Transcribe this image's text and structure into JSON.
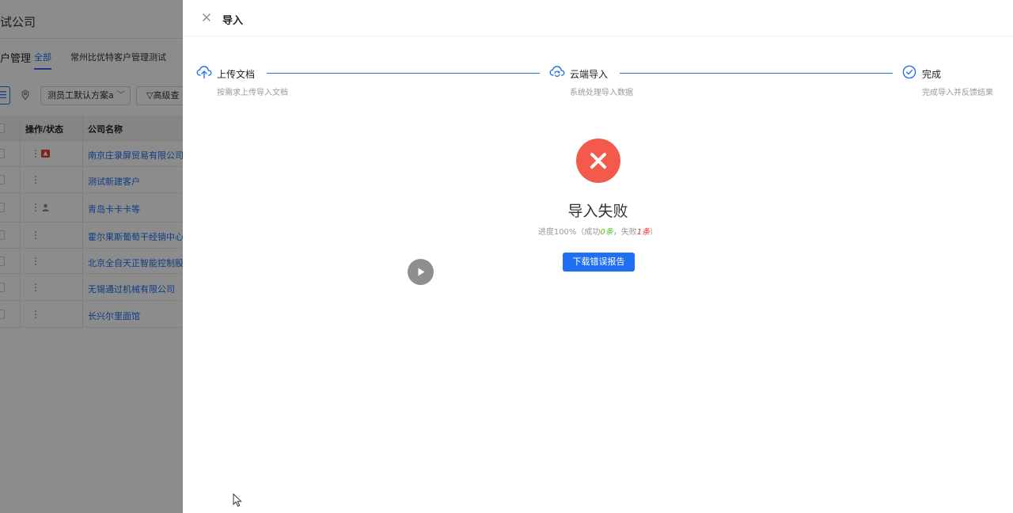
{
  "background": {
    "company_title": "试公司",
    "module_title": "户管理",
    "tabs": [
      {
        "label": "全部",
        "active": true
      },
      {
        "label": "常州比优特客户管理测试",
        "active": false
      }
    ],
    "toolbar": {
      "menu_icon": "list-icon",
      "pin_icon": "location-pin-icon",
      "scheme_dropdown": "测员工默认方案a",
      "advanced_search": "高级查"
    },
    "table": {
      "headers": [
        "操作/状态",
        "公司名称"
      ],
      "rows": [
        {
          "name": "南京庄录屏贸易有限公司",
          "status_icon": "red-alert-badge-icon"
        },
        {
          "name": "测试新建客户",
          "status_icon": ""
        },
        {
          "name": "青岛卡卡卡等",
          "status_icon": "person-icon"
        },
        {
          "name": "霍尔果斯葡萄干经销中心",
          "status_icon": ""
        },
        {
          "name": "北京全自天正智能控制股",
          "status_icon": ""
        },
        {
          "name": "无锡通过机械有限公司",
          "status_icon": ""
        },
        {
          "name": "长兴尔里面馆",
          "status_icon": ""
        }
      ]
    }
  },
  "drawer": {
    "title": "导入",
    "steps": [
      {
        "title": "上传文档",
        "desc": "按需求上传导入文档",
        "icon": "cloud-upload-icon"
      },
      {
        "title": "云端导入",
        "desc": "系统处理导入数据",
        "icon": "cloud-sync-icon"
      },
      {
        "title": "完成",
        "desc": "完成导入并反馈结果",
        "icon": "check-circle-icon"
      }
    ],
    "result": {
      "icon": "error-x-icon",
      "status_color": "#f45a4b",
      "title": "导入失败",
      "progress_prefix": "进度100%（成功",
      "success_count": "0条",
      "middle": "，失败",
      "fail_count": "1条",
      "progress_suffix": "）",
      "download_button": "下载错误报告"
    }
  },
  "colors": {
    "accent": "#1e6ff1",
    "error": "#f45a4b",
    "success": "#52c41a"
  }
}
